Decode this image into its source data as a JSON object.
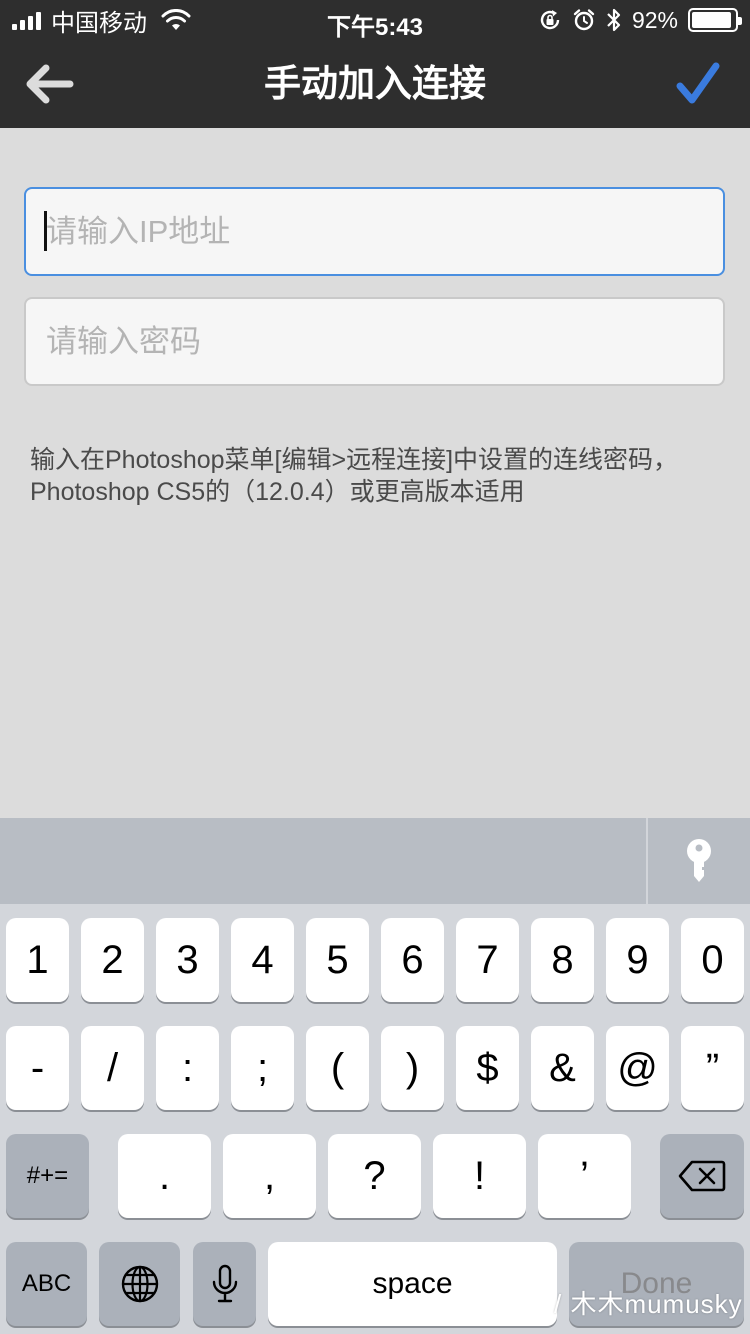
{
  "status_bar": {
    "carrier": "中国移动",
    "time": "下午5:43",
    "battery_text": "92%",
    "battery_level": 0.92
  },
  "nav": {
    "back_icon": "arrow-left-icon",
    "title": "手动加入连接",
    "done_icon": "checkmark-icon",
    "accent_color": "#3a7bde"
  },
  "form": {
    "ip_placeholder": "请输入IP地址",
    "password_placeholder": "请输入密码",
    "hint": "输入在Photoshop菜单[编辑>远程连接]中设置的连线密码，Photoshop CS5的（12.0.4）或更高版本适用"
  },
  "keyboard": {
    "row1": [
      "1",
      "2",
      "3",
      "4",
      "5",
      "6",
      "7",
      "8",
      "9",
      "0"
    ],
    "row2": [
      "-",
      "/",
      ":",
      ";",
      "(",
      ")",
      "$",
      "&",
      "@",
      "”"
    ],
    "row3": [
      ".",
      ",",
      "?",
      "!",
      "’"
    ],
    "symbols_key": "#+=",
    "abc_key": "ABC",
    "space_key": "space",
    "done_key": "Done"
  },
  "watermark": "/ 木木mumusky"
}
